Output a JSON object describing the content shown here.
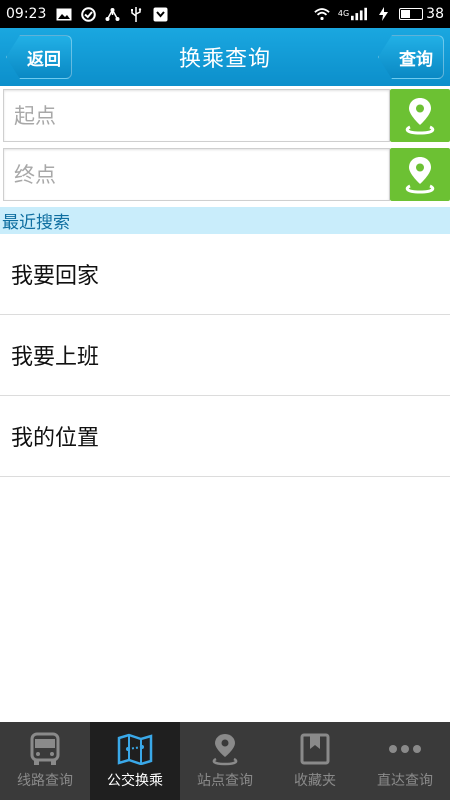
{
  "status_bar": {
    "time": "09:23",
    "network": "4G",
    "battery": "38",
    "battery_level": 0.38
  },
  "header": {
    "title": "换乘查询",
    "back_label": "返回",
    "query_label": "查询"
  },
  "inputs": {
    "start_placeholder": "起点",
    "end_placeholder": "终点"
  },
  "recent": {
    "header": "最近搜索",
    "items": [
      "我要回家",
      "我要上班",
      "我的位置"
    ]
  },
  "tabs": [
    {
      "label": "线路查询",
      "icon": "bus-icon",
      "active": false
    },
    {
      "label": "公交换乘",
      "icon": "map-icon",
      "active": true
    },
    {
      "label": "站点查询",
      "icon": "location-pin-icon",
      "active": false
    },
    {
      "label": "收藏夹",
      "icon": "bookmark-icon",
      "active": false
    },
    {
      "label": "直达查询",
      "icon": "more-icon",
      "active": false
    }
  ],
  "colors": {
    "header_blue": "#0c8fcb",
    "location_green": "#6cc133",
    "recent_header_bg": "#c9edfb",
    "tabbar_bg": "#3a3a3a"
  }
}
